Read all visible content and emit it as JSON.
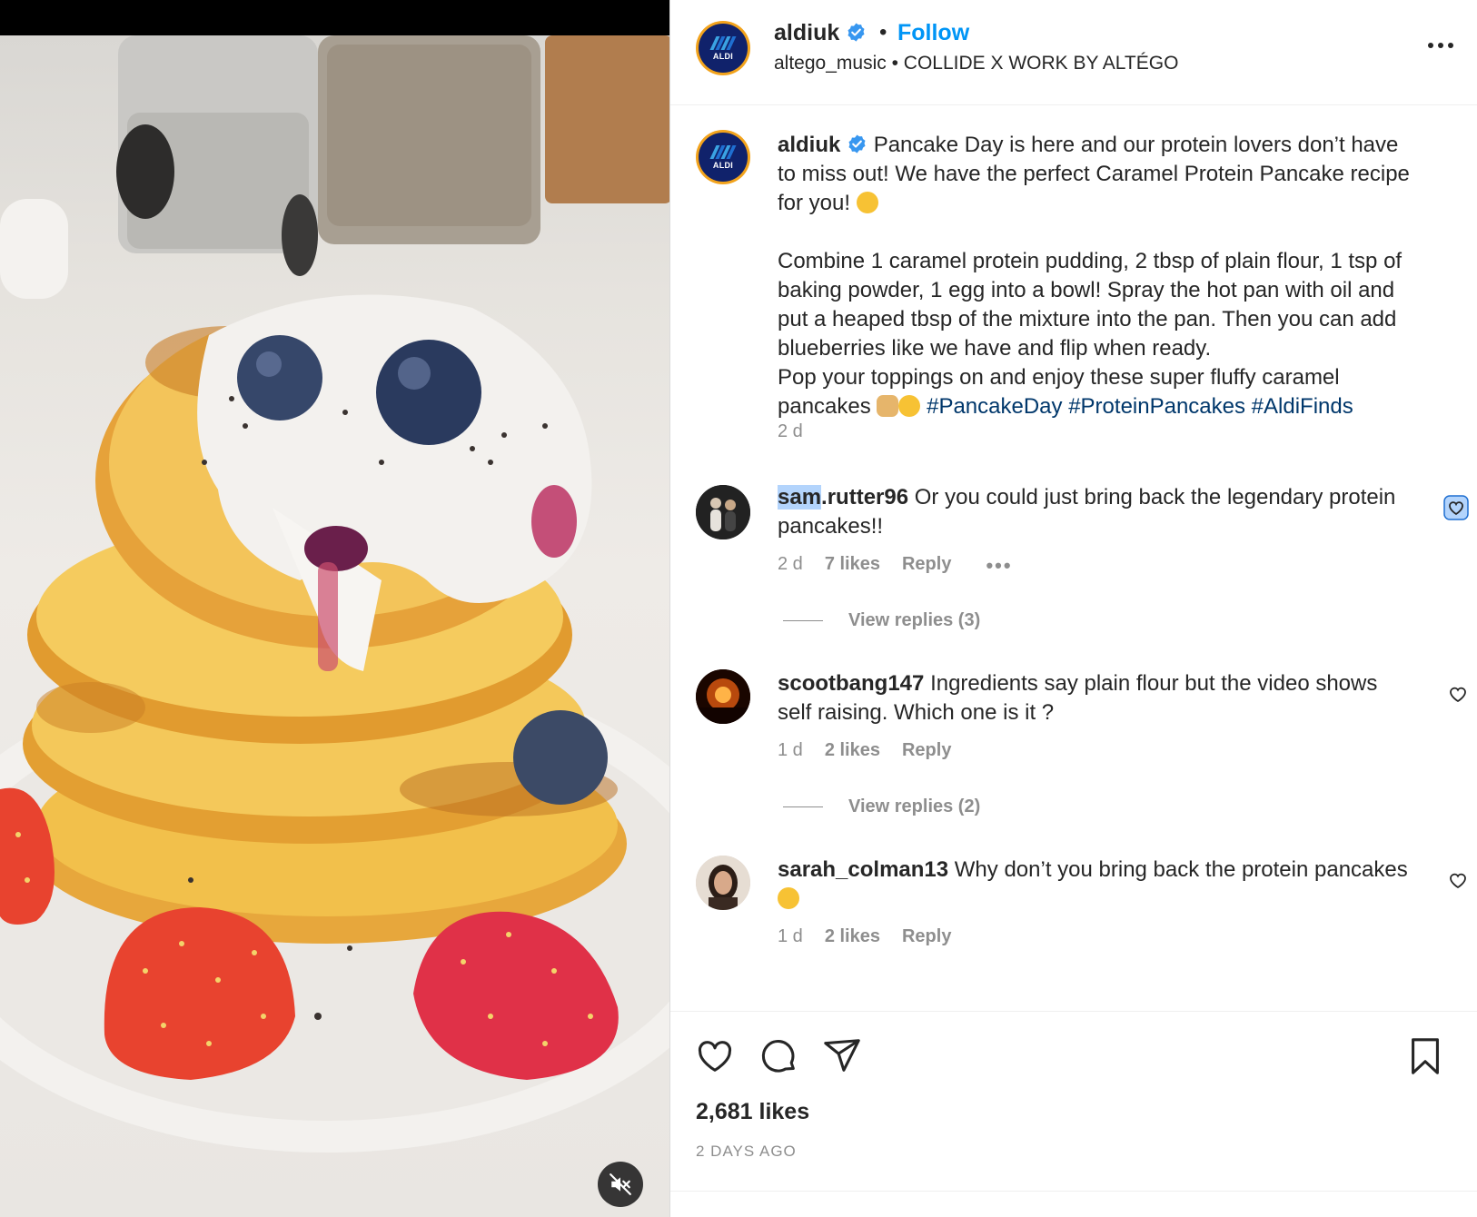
{
  "post": {
    "account": "aldiuk",
    "follow_label": "Follow",
    "separator": "•",
    "audio_artist": "altego_music",
    "audio_track": "COLLIDE X WORK BY ALTÉGO",
    "avatar_text": "ALDI",
    "brand_colors": {
      "navy": "#10226b",
      "orange": "#f2a31c",
      "light_blue": "#3aa3e3",
      "blue": "#1f6fd1"
    }
  },
  "caption": {
    "username": "aldiuk",
    "text_part1": "Pancake Day is here and our protein lovers don’t have to miss out! We have the perfect Caramel Protein Pancake recipe for you!",
    "text_part2": "Combine 1 caramel protein pudding, 2 tbsp of plain flour, 1 tsp of baking powder, 1 egg into a bowl! Spray the hot pan with oil and put a heaped tbsp of the mixture into the pan. Then you can add blueberries like we have and flip when ready.",
    "text_part3": "Pop your toppings on and enjoy these super fluffy caramel pancakes",
    "hashtags": [
      "#PancakeDay",
      "#ProteinPancakes",
      "#AldiFinds"
    ],
    "time": "2 d",
    "emojis": [
      "yum-face",
      "pancakes",
      "smiling-face-with-hearts"
    ]
  },
  "comments": [
    {
      "username_highlight": "sam",
      "username_rest": ".rutter96",
      "text": "Or you could just bring back the legendary protein pancakes!!",
      "time": "2 d",
      "likes": "7 likes",
      "reply": "Reply",
      "more": "•••",
      "view_replies": "View replies (3)",
      "liked_state": "selected"
    },
    {
      "username": "scootbang147",
      "text": "Ingredients say plain flour but the video shows self raising. Which one is it ?",
      "time": "1 d",
      "likes": "2 likes",
      "reply": "Reply",
      "view_replies": "View replies (2)"
    },
    {
      "username": "sarah_colman13",
      "text": "Why don’t you bring back the protein pancakes",
      "time": "1 d",
      "likes": "2 likes",
      "reply": "Reply",
      "emoji": "crying-face"
    }
  ],
  "footer": {
    "likes": "2,681 likes",
    "date": "2 DAYS AGO"
  },
  "icons": [
    "heart-icon",
    "comment-icon",
    "share-icon",
    "bookmark-icon",
    "more-icon",
    "mute-icon",
    "verified-icon"
  ]
}
